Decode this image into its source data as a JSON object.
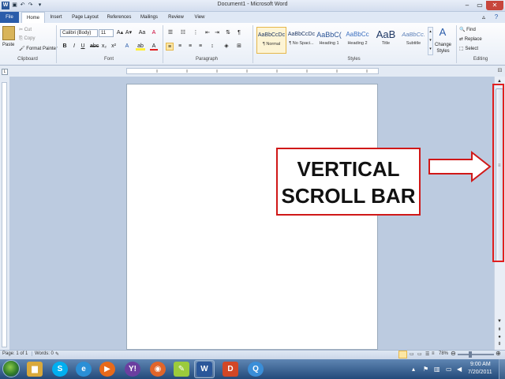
{
  "window": {
    "title": "Document1 - Microsoft Word",
    "app_icon": "W"
  },
  "quick_access": [
    "save-icon",
    "undo-icon",
    "redo-icon",
    "customize-icon"
  ],
  "tabs": [
    "File",
    "Home",
    "Insert",
    "Page Layout",
    "References",
    "Mailings",
    "Review",
    "View"
  ],
  "clipboard": {
    "paste": "Paste",
    "cut": "Cut",
    "copy": "Copy",
    "format_painter": "Format Painter",
    "group": "Clipboard"
  },
  "font": {
    "name": "Calibri (Body)",
    "size": "11",
    "group": "Font",
    "bold": "B",
    "italic": "I",
    "underline": "U",
    "aa": "Aa"
  },
  "paragraph": {
    "group": "Paragraph",
    "pilcrow": "¶"
  },
  "styles": {
    "group": "Styles",
    "items": [
      {
        "sample": "AaBbCcDc",
        "name": "¶ Normal"
      },
      {
        "sample": "AaBbCcDc",
        "name": "¶ No Spaci..."
      },
      {
        "sample": "AaBbC(",
        "name": "Heading 1"
      },
      {
        "sample": "AaBbCc",
        "name": "Heading 2"
      },
      {
        "sample": "AaB",
        "name": "Title"
      },
      {
        "sample": "AaBbCc.",
        "name": "Subtitle"
      }
    ],
    "change_styles": "Change Styles",
    "change_styles_line1": "Change",
    "change_styles_line2": "Styles"
  },
  "editing": {
    "group": "Editing",
    "find": "Find",
    "replace": "Replace",
    "select": "Select"
  },
  "callout": {
    "line1": "VERTICAL",
    "line2": "SCROLL BAR"
  },
  "status": {
    "page": "Page: 1 of 1",
    "words": "Words: 0",
    "zoom": "78%",
    "zoom_level": 0.78
  },
  "clock": {
    "time": "9:00 AM",
    "date": "7/20/2011"
  },
  "colors": {
    "file_tab": "#2a5caa",
    "highlight": "#e02020",
    "taskbar": "#234a7a"
  }
}
